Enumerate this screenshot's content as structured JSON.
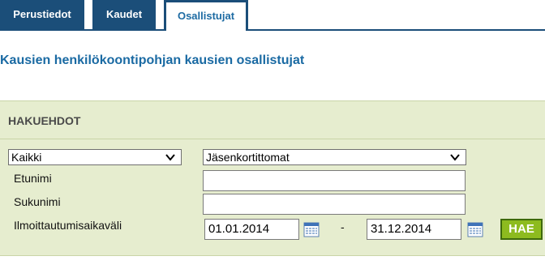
{
  "tabs": [
    {
      "label": "Perustiedot",
      "active": false
    },
    {
      "label": "Kaudet",
      "active": false
    },
    {
      "label": "Osallistujat",
      "active": true
    }
  ],
  "page": {
    "title": "Kausien henkilökoontipohjan kausien osallistujat"
  },
  "search": {
    "header": "HAKUEHDOT",
    "select1": {
      "value": "Kaikki"
    },
    "select2": {
      "value": "Jäsenkortittomat"
    },
    "firstname_label": "Etunimi",
    "firstname_value": "",
    "lastname_label": "Sukunimi",
    "lastname_value": "",
    "period_label": "Ilmoittautumisaikaväli",
    "date_from": "01.01.2014",
    "date_separator": "-",
    "date_to": "31.12.2014",
    "submit_label": "HAE"
  },
  "colors": {
    "tab_bg": "#1b4e79",
    "title": "#1a6aa3",
    "panel_bg": "#e6edcf",
    "button": "#8dbb1f"
  }
}
